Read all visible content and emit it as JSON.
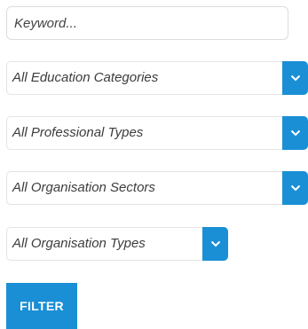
{
  "search": {
    "placeholder": "Keyword...",
    "value": ""
  },
  "filters": [
    {
      "label": "All Education Categories"
    },
    {
      "label": "All Professional Types"
    },
    {
      "label": "All Organisation Sectors"
    },
    {
      "label": "All Organisation Types"
    }
  ],
  "filter_button": {
    "label": "FILTER"
  },
  "colors": {
    "accent": "#1a8fd6",
    "border": "#e4e4e4",
    "text": "#3c3c3c"
  },
  "icons": {
    "dropdown": "chevron-down-icon"
  }
}
